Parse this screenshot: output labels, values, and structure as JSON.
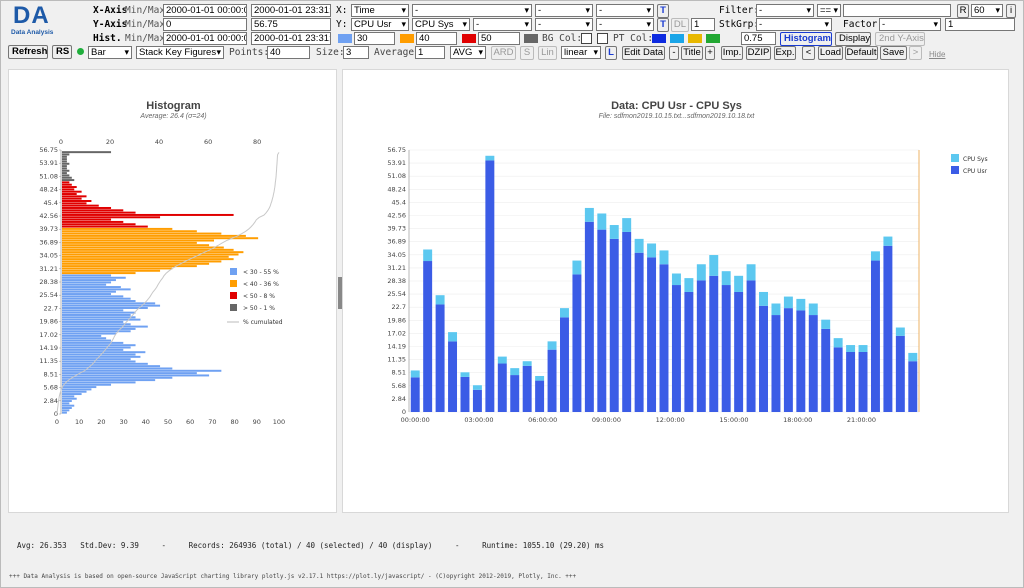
{
  "app": {
    "logo_big": "DA",
    "logo_small": "Data Analysis"
  },
  "toolbar": {
    "xaxis_label": "X-Axis",
    "minmax": "Min/Max",
    "yaxis_label": "Y-Axis",
    "hist_label": "Hist.",
    "x_min": "2000-01-01 00:00:00",
    "x_max": "2000-01-01 23:31:0",
    "y_min": "0",
    "y_max": "56.75",
    "h_min": "2000-01-01 00:00:00",
    "h_max": "2000-01-01 23:31:0",
    "x_sel_label": "X:",
    "x_field": "Time",
    "x_extra": [
      "-",
      "-",
      "-"
    ],
    "y_sel_label": "Y:",
    "y_field1": "CPU Usr",
    "y_field2": "CPU Sys",
    "y_extra": [
      "-",
      "-",
      "-"
    ],
    "t_label": "T",
    "dl_label": "DL",
    "dl_value": "1",
    "thresholds": [
      "30",
      "40",
      "50"
    ],
    "threshold_colors": [
      "#6fa1f2",
      "#ff9d00",
      "#e00000",
      "#666666"
    ],
    "bgcol_label": "BG Col:",
    "ptcol_label": "PT Col:",
    "pt_colors": [
      "#0c2ae0",
      "#1aa5e8",
      "#e8b800",
      "#22a832"
    ],
    "opacity": "0.75",
    "histogram_btn": "Histogram",
    "display_btn": "Display",
    "second_y_btn": "2nd Y-Axis",
    "filter_label": "Filter:",
    "filter_field": "-",
    "filter_op": "==",
    "filter_value": "",
    "r_label": "R",
    "r_value": "60",
    "i_label": "i",
    "stkgrp_label": "StkGrp:",
    "stkgrp_value": "-",
    "factor_label": "Factor:",
    "factor_value": "-",
    "factor_num": "1",
    "refresh_btn": "Refresh",
    "rs_btn": "RS",
    "chart_type": "Bar",
    "stack_mode": "Stack Key Figures",
    "points_label": "Points:",
    "points_value": "40",
    "size_label": "Size:",
    "size_value": "3",
    "average_label": "Average:",
    "average_value": "1",
    "avg_mode": "AVG",
    "ard_btn": "ARD",
    "s_btn": "S",
    "lin_btn": "Lin",
    "scale": "linear",
    "l_btn": "L",
    "edit_btn": "Edit Data",
    "minus_btn": "-",
    "title_btn": "Title",
    "plus_btn": "+",
    "imp_btn": "Imp.",
    "dzip_btn": "DZIP",
    "exp_btn": "Exp.",
    "lt_btn": "<",
    "load_btn": "Load",
    "default_btn": "Default",
    "save_btn": "Save",
    "gt_btn": ">",
    "hide_link": "Hide"
  },
  "hist_panel": {
    "title": "Histogram",
    "subtitle": "Average: 26.4 (σ=24)",
    "cum_label": "% cumulated"
  },
  "chart_data": [
    {
      "type": "bar",
      "title": "Histogram",
      "subtitle": "Average: 26.4 (σ=24)",
      "orientation": "horizontal",
      "y_ticks": [
        "56.75",
        "53.91",
        "51.08",
        "48.24",
        "45.4",
        "42.56",
        "39.73",
        "36.89",
        "34.05",
        "31.21",
        "28.38",
        "25.54",
        "22.7",
        "19.86",
        "17.02",
        "14.19",
        "11.35",
        "8.51",
        "5.68",
        "2.84",
        "0"
      ],
      "x_top_ticks": [
        "0",
        "20",
        "40",
        "60",
        "80"
      ],
      "x_bottom_ticks": [
        "0",
        "10",
        "20",
        "30",
        "40",
        "50",
        "60",
        "70",
        "80",
        "90",
        "100"
      ],
      "ylim": [
        0,
        56.75
      ],
      "xlim_counts": [
        0,
        93
      ],
      "bin_width": 0.5,
      "legend": [
        {
          "label": "< 30 - 55 %",
          "color": "#6fa1f2"
        },
        {
          "label": "< 40 - 36 %",
          "color": "#ff9d00"
        },
        {
          "label": "< 50 - 8 %",
          "color": "#e00000"
        },
        {
          "label": "> 50 - 1 %",
          "color": "#666666"
        }
      ],
      "counts": [
        2,
        3,
        4,
        5,
        3,
        4,
        6,
        5,
        8,
        10,
        12,
        14,
        20,
        30,
        38,
        45,
        60,
        55,
        65,
        45,
        40,
        35,
        30,
        28,
        32,
        30,
        34,
        25,
        28,
        30,
        25,
        20,
        18,
        16,
        22,
        28,
        30,
        35,
        28,
        25,
        32,
        30,
        28,
        30,
        25,
        35,
        40,
        38,
        30,
        28,
        25,
        20,
        22,
        28,
        24,
        18,
        20,
        22,
        26,
        20,
        30,
        40,
        45,
        55,
        60,
        65,
        70,
        68,
        72,
        74,
        70,
        66,
        60,
        55,
        62,
        80,
        75,
        65,
        55,
        45,
        35,
        30,
        25,
        20,
        40,
        70,
        30,
        25,
        20,
        15,
        10,
        12,
        8,
        10,
        6,
        8,
        5,
        6,
        4,
        3,
        5,
        4,
        3,
        2,
        3,
        2,
        2,
        3,
        2,
        2,
        2,
        3,
        20
      ]
    },
    {
      "type": "bar",
      "title": "Data: CPU Usr - CPU Sys",
      "subtitle": "File: sdfmon2019.10.15.txt...sdfmon2019.10.18.txt",
      "stacked": true,
      "x": [
        "00:00",
        "00:35",
        "01:10",
        "01:45",
        "02:20",
        "02:55",
        "03:30",
        "04:05",
        "04:40",
        "05:15",
        "05:50",
        "06:25",
        "07:00",
        "07:35",
        "08:10",
        "08:45",
        "09:20",
        "09:55",
        "10:30",
        "11:05",
        "11:40",
        "12:15",
        "12:50",
        "13:25",
        "14:00",
        "14:35",
        "15:10",
        "15:45",
        "16:20",
        "16:55",
        "17:30",
        "18:05",
        "18:40",
        "19:15",
        "19:50",
        "20:25",
        "21:00",
        "21:35",
        "22:10",
        "22:45"
      ],
      "x_tick_labels": [
        "00:00:00",
        "03:00:00",
        "06:00:00",
        "09:00:00",
        "12:00:00",
        "15:00:00",
        "18:00:00",
        "21:00:00"
      ],
      "y_ticks": [
        "56.75",
        "53.91",
        "51.08",
        "48.24",
        "45.4",
        "42.56",
        "39.73",
        "36.89",
        "34.05",
        "31.21",
        "28.38",
        "25.54",
        "22.7",
        "19.86",
        "17.02",
        "14.19",
        "11.35",
        "8.51",
        "5.68",
        "2.84",
        "0"
      ],
      "ylim": [
        0,
        56.75
      ],
      "series": [
        {
          "name": "CPU Usr",
          "color": "#3b5ce6",
          "values": [
            7.5,
            32.7,
            23.3,
            15.3,
            7.6,
            4.8,
            54.5,
            10.5,
            8.0,
            10.0,
            6.8,
            13.5,
            20.5,
            29.8,
            41.2,
            39.5,
            37.5,
            39.0,
            34.5,
            33.5,
            32.0,
            27.5,
            26.0,
            28.5,
            29.5,
            27.5,
            26.0,
            28.5,
            23.0,
            21.0,
            22.5,
            22.0,
            21.0,
            18.0,
            14.0,
            13.0,
            13.0,
            32.8,
            36.0,
            16.5,
            11.0
          ]
        },
        {
          "name": "CPU Sys",
          "color": "#5cc8f0",
          "values": [
            1.5,
            2.5,
            2.0,
            2.0,
            1.0,
            1.0,
            1.0,
            1.5,
            1.5,
            1.0,
            1.0,
            1.8,
            2.0,
            3.0,
            3.0,
            3.5,
            3.0,
            3.0,
            3.0,
            3.0,
            3.0,
            2.5,
            3.0,
            3.5,
            4.5,
            3.0,
            3.5,
            3.5,
            3.0,
            2.5,
            2.5,
            2.5,
            2.5,
            2.0,
            2.0,
            1.5,
            1.5,
            2.0,
            2.0,
            1.8,
            1.8
          ]
        }
      ]
    }
  ],
  "data_panel": {
    "title": "Data: CPU Usr - CPU Sys",
    "subtitle": "File: sdfmon2019.10.15.txt...sdfmon2019.10.18.txt"
  },
  "status": {
    "avg": "Avg: 26.353",
    "stddev": "Std.Dev: 9.39",
    "sep1": "-",
    "records": "Records: 264936 (total) / 40 (selected) / 40 (display)",
    "sep2": "-",
    "runtime": "Runtime: 1055.10 (29.20) ms"
  },
  "footer": {
    "credit": "+++ Data Analysis is based on open-source JavaScript charting library plotly.js v2.17.1 https://plot.ly/javascript/ - (C)opyright 2012-2019, Plotly, Inc. +++"
  }
}
